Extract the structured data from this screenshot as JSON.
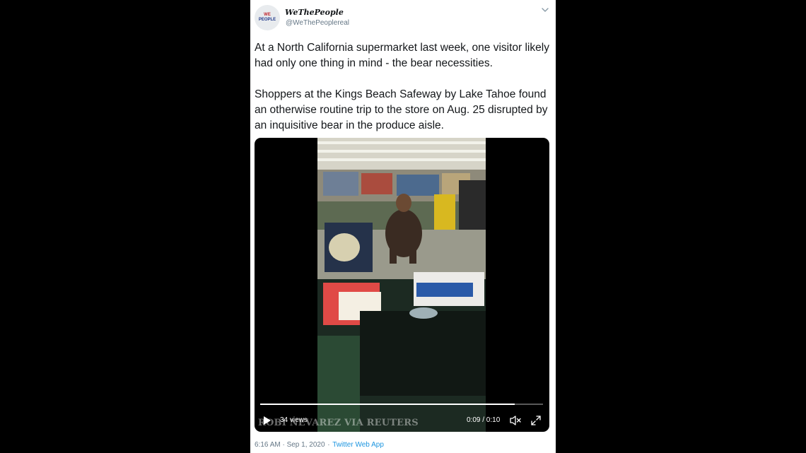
{
  "tweet": {
    "author_name": "WeThePeople",
    "author_handle": "@WeThePeoplereal",
    "avatar_text_line1": "WE",
    "avatar_text_line2": "PEOPLE",
    "paragraphs": [
      "At a North California supermarket last week, one visitor likely had only one thing in mind - the bear necessities.",
      "Shoppers at the Kings Beach Safeway by Lake Tahoe found an otherwise routine trip to the store on Aug. 25 disrupted by an inquisitive bear in the produce aisle."
    ],
    "timestamp": "6:16 AM · Sep 1, 2020",
    "separator": "·",
    "source_app": "Twitter Web App"
  },
  "video": {
    "views": "34 views",
    "time_display": "0:09 / 0:10",
    "progress_fraction": 0.9,
    "watermark": "ROBI NEVAREZ VIA REUTERS"
  },
  "icons": {
    "caret": "chevron-down-icon",
    "play": "play-icon",
    "mute": "volume-muted-icon",
    "fullscreen": "fullscreen-icon"
  },
  "colors": {
    "background": "#000000",
    "card": "#ffffff",
    "text": "#14171a",
    "secondary": "#657786",
    "link": "#1b95e0"
  }
}
